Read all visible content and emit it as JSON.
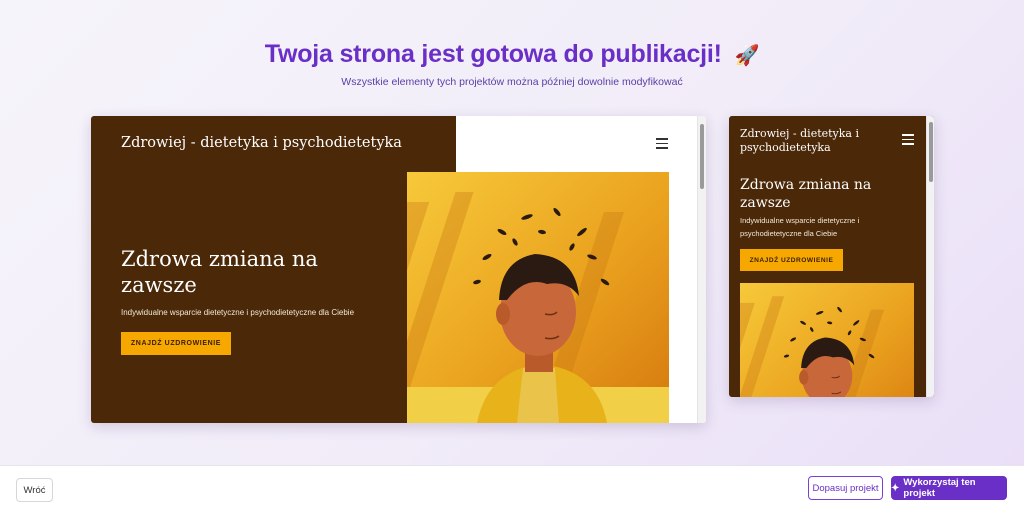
{
  "header": {
    "title": "Twoja strona jest gotowa do publikacji!",
    "title_icon": "🚀",
    "subtitle": "Wszystkie elementy tych projektów można później dowolnie modyfikować"
  },
  "desktop_preview": {
    "logo": "Zdrowiej - dietetyka i psychodietetyka",
    "hero_title": "Zdrowa zmiana na zawsze",
    "hero_subtitle": "Indywidualne wsparcie dietetyczne i psychodietetyczne dla Ciebie",
    "cta_label": "ZNAJDŹ UZDROWIENIE"
  },
  "mobile_preview": {
    "logo": "Zdrowiej - dietetyka i psychodietetyka",
    "hero_title": "Zdrowa zmiana na zawsze",
    "hero_subtitle": "Indywidualne wsparcie dietetyczne i psychodietetyczne dla Ciebie",
    "cta_label": "ZNAJDŹ UZDROWIENIE"
  },
  "footer": {
    "back_label": "Wróć",
    "adjust_label": "Dopasuj projekt",
    "use_label": "Wykorzystaj ten projekt",
    "use_icon": "sparkles-icon"
  },
  "colors": {
    "accent": "#6a2fc7",
    "hero_background": "#4a2808",
    "cta": "#f6a800"
  }
}
